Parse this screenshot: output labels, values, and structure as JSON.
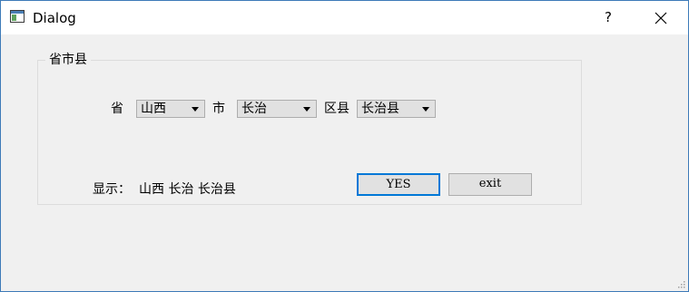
{
  "window": {
    "title": "Dialog",
    "help_label": "?"
  },
  "group": {
    "title": "省市县"
  },
  "form": {
    "province_label": "省",
    "province_value": "山西",
    "city_label": "市",
    "city_value": "长治",
    "county_label": "区县",
    "county_value": "长治县"
  },
  "display": {
    "label": "显示：",
    "text": "山西 长治 长治县"
  },
  "buttons": {
    "yes": "YES",
    "exit": "exit"
  },
  "colors": {
    "accent": "#0078d7",
    "window_border": "#3d7ab8",
    "background": "#f0f0f0"
  }
}
